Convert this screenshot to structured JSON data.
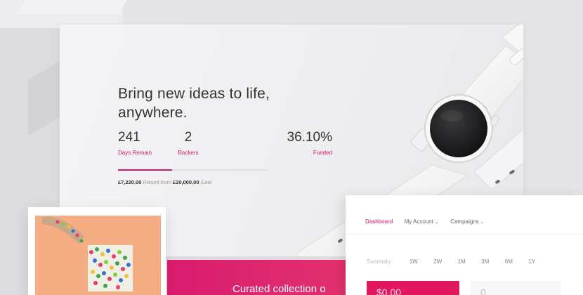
{
  "hero": {
    "title": "Bring new ideas to life, anywhere.",
    "stats": [
      {
        "value": "241",
        "label": "Days Remain"
      },
      {
        "value": "2",
        "label": "Backers"
      },
      {
        "value": "36.10%",
        "label": "Funded"
      }
    ],
    "progress_fraction": 0.361,
    "raised_amount": "£7,220.00",
    "raised_text": " Raised from ",
    "goal_amount": "£20,000.00",
    "goal_text": " Goal"
  },
  "promo": {
    "text": "Curated collection o"
  },
  "dashboard": {
    "nav": {
      "dashboard": "Dashboard",
      "my_account": "My Account",
      "campaigns": "Campaigns"
    },
    "ranges": [
      "Summary",
      "1W",
      "2W",
      "1M",
      "3M",
      "6M",
      "1Y"
    ],
    "amount": "$0.00",
    "count": "0"
  },
  "colors": {
    "accent": "#d6186b",
    "background": "#e4e4e6"
  },
  "icons": {
    "watch": "smartwatch-image",
    "photo": "sprinkles-photo",
    "chevron": "chevron-down-icon"
  }
}
